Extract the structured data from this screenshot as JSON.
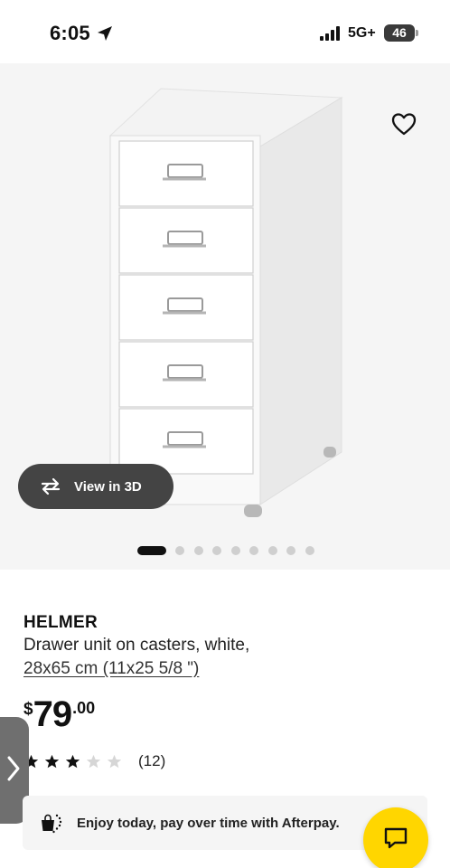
{
  "status_bar": {
    "time": "6:05",
    "network": "5G+",
    "battery": "46",
    "icons": [
      "location-arrow-icon",
      "signal-bars-icon",
      "battery-icon"
    ]
  },
  "gallery": {
    "view_3d_label": "View in 3D",
    "image_count": 9,
    "active_index": 0,
    "icons": [
      "heart-icon",
      "rotate-3d-icon"
    ]
  },
  "product": {
    "name": "HELMER",
    "description": "Drawer unit on casters, white,",
    "dimensions": "28x65 cm (11x25 5/8 \")",
    "price": {
      "currency": "$",
      "integer": "79",
      "decimal": ".00"
    },
    "rating": {
      "stars": 3,
      "max": 5,
      "count_label": "(12)"
    }
  },
  "afterpay": {
    "text": "Enjoy today, pay over time with Afterpay.",
    "icon": "afterpay-bag-icon"
  },
  "chat": {
    "icon": "chat-bubble-icon"
  },
  "colors": {
    "accent_yellow": "#ffd600",
    "pill_dark": "#444444",
    "gallery_bg": "#f5f5f5",
    "star_filled": "#111111",
    "star_empty": "#d6d6d6"
  }
}
